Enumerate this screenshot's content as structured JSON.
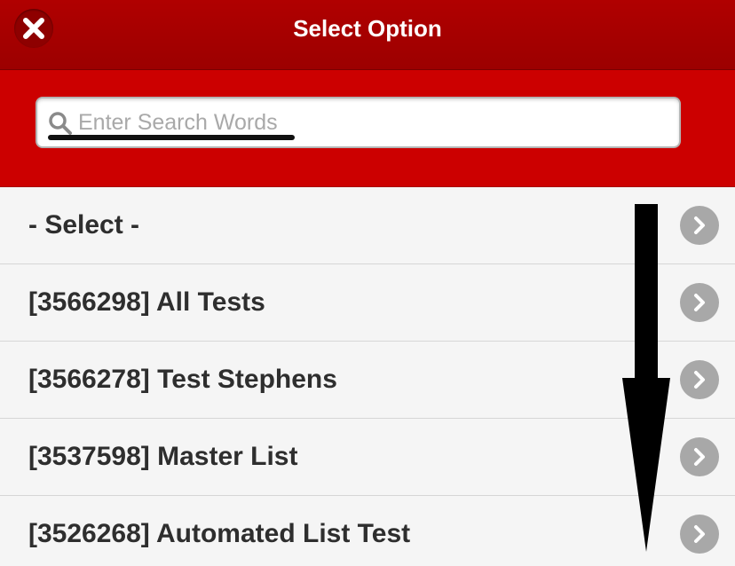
{
  "header": {
    "title": "Select Option",
    "close_icon": "close-icon"
  },
  "search": {
    "placeholder": "Enter Search Words",
    "value": "",
    "icon": "search-icon"
  },
  "options": [
    {
      "label": "- Select -"
    },
    {
      "label": "[3566298] All Tests"
    },
    {
      "label": "[3566278] Test Stephens"
    },
    {
      "label": "[3537598] Master List"
    },
    {
      "label": "[3526268] Automated List Test"
    }
  ],
  "colors": {
    "titlebar": "#a80000",
    "searchbar": "#cc0000",
    "chevron": "#a8a8a8",
    "text": "#2e2e2e"
  }
}
